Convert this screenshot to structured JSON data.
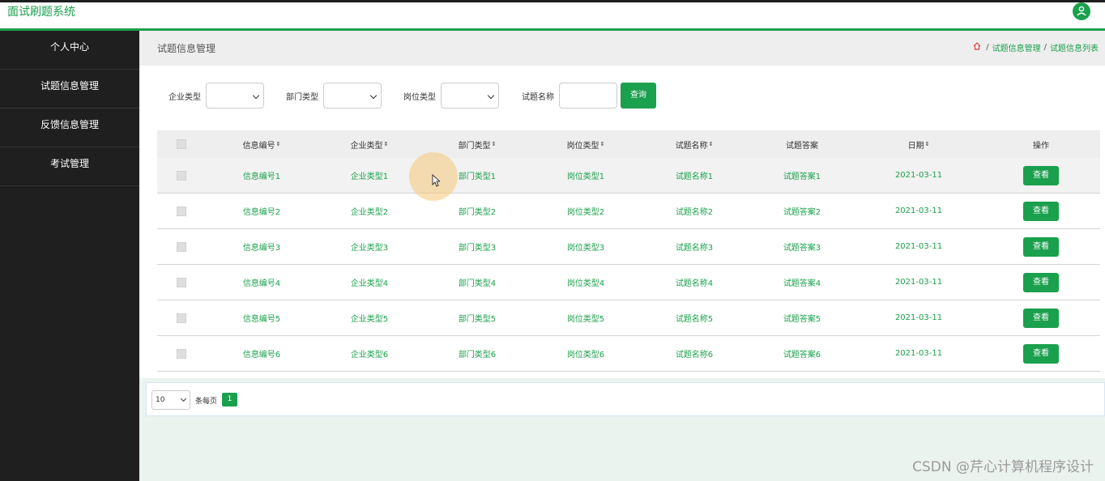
{
  "app": {
    "title": "面试刷题系统"
  },
  "sidebar": {
    "items": [
      {
        "label": "个人中心"
      },
      {
        "label": "试题信息管理"
      },
      {
        "label": "反馈信息管理"
      },
      {
        "label": "考试管理"
      }
    ]
  },
  "breadcrumb": {
    "page_title": "试题信息管理",
    "path": [
      "试题信息管理",
      "试题信息列表"
    ],
    "separator": "/"
  },
  "filters": {
    "company_type_label": "企业类型",
    "department_type_label": "部门类型",
    "position_type_label": "岗位类型",
    "question_name_label": "试题名称",
    "query_button": "查询"
  },
  "table": {
    "headers": {
      "info_no": "信息编号",
      "company_type": "企业类型",
      "department_type": "部门类型",
      "position_type": "岗位类型",
      "question_name": "试题名称",
      "question_answer": "试题答案",
      "date": "日期",
      "action": "操作"
    },
    "sort_glyph": "⇕",
    "view_button": "查看",
    "rows": [
      {
        "info_no": "信息编号1",
        "company_type": "企业类型1",
        "department_type": "部门类型1",
        "position_type": "岗位类型1",
        "question_name": "试题名称1",
        "question_answer": "试题答案1",
        "date": "2021-03-11"
      },
      {
        "info_no": "信息编号2",
        "company_type": "企业类型2",
        "department_type": "部门类型2",
        "position_type": "岗位类型2",
        "question_name": "试题名称2",
        "question_answer": "试题答案2",
        "date": "2021-03-11"
      },
      {
        "info_no": "信息编号3",
        "company_type": "企业类型3",
        "department_type": "部门类型3",
        "position_type": "岗位类型3",
        "question_name": "试题名称3",
        "question_answer": "试题答案3",
        "date": "2021-03-11"
      },
      {
        "info_no": "信息编号4",
        "company_type": "企业类型4",
        "department_type": "部门类型4",
        "position_type": "岗位类型4",
        "question_name": "试题名称4",
        "question_answer": "试题答案4",
        "date": "2021-03-11"
      },
      {
        "info_no": "信息编号5",
        "company_type": "企业类型5",
        "department_type": "部门类型5",
        "position_type": "岗位类型5",
        "question_name": "试题名称5",
        "question_answer": "试题答案5",
        "date": "2021-03-11"
      },
      {
        "info_no": "信息编号6",
        "company_type": "企业类型6",
        "department_type": "部门类型6",
        "position_type": "岗位类型6",
        "question_name": "试题名称6",
        "question_answer": "试题答案6",
        "date": "2021-03-11"
      }
    ]
  },
  "pagination": {
    "page_size": "10",
    "page_size_suffix": "条每页",
    "current_page": "1"
  },
  "watermark": "CSDN @芹心计算机程序设计",
  "colors": {
    "accent": "#1ba04d",
    "sidebar_bg": "#1f1f1f"
  }
}
